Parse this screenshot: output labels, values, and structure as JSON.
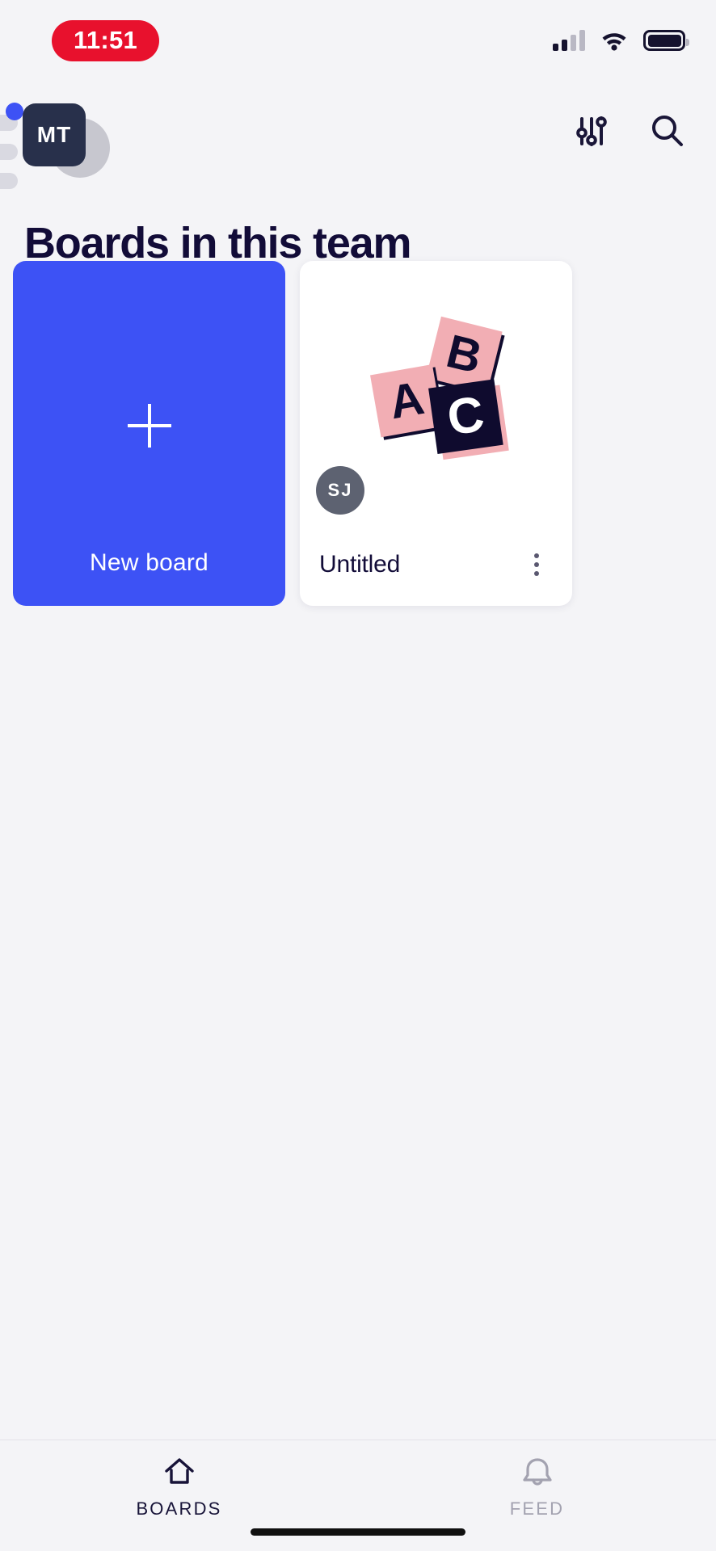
{
  "status_bar": {
    "time": "11:51",
    "recording_indicator": true,
    "cellular_icon": "signal-bars-icon",
    "wifi_icon": "wifi-icon",
    "battery_icon": "battery-icon"
  },
  "top_bar": {
    "team_avatar_initials": "MT",
    "notification_badge": true,
    "filter_icon": "sliders-icon",
    "search_icon": "search-icon"
  },
  "header": {
    "title": "Boards in this team"
  },
  "boards": {
    "new_board": {
      "label": "New board",
      "icon": "plus-icon",
      "accent_color": "#3d52f5"
    },
    "items": [
      {
        "name": "Untitled",
        "owner_initials": "SJ",
        "menu_icon": "kebab-menu-icon",
        "thumbnail": "abc-blocks-illustration"
      }
    ]
  },
  "tab_bar": {
    "tabs": [
      {
        "label": "BOARDS",
        "icon": "home-icon",
        "active": true
      },
      {
        "label": "FEED",
        "icon": "bell-icon",
        "active": false
      }
    ]
  },
  "colors": {
    "background": "#f4f4f7",
    "accent_blue": "#3d52f5",
    "ink": "#120c38",
    "block_pink": "#f2aeb4",
    "recording_red": "#e8112d"
  }
}
